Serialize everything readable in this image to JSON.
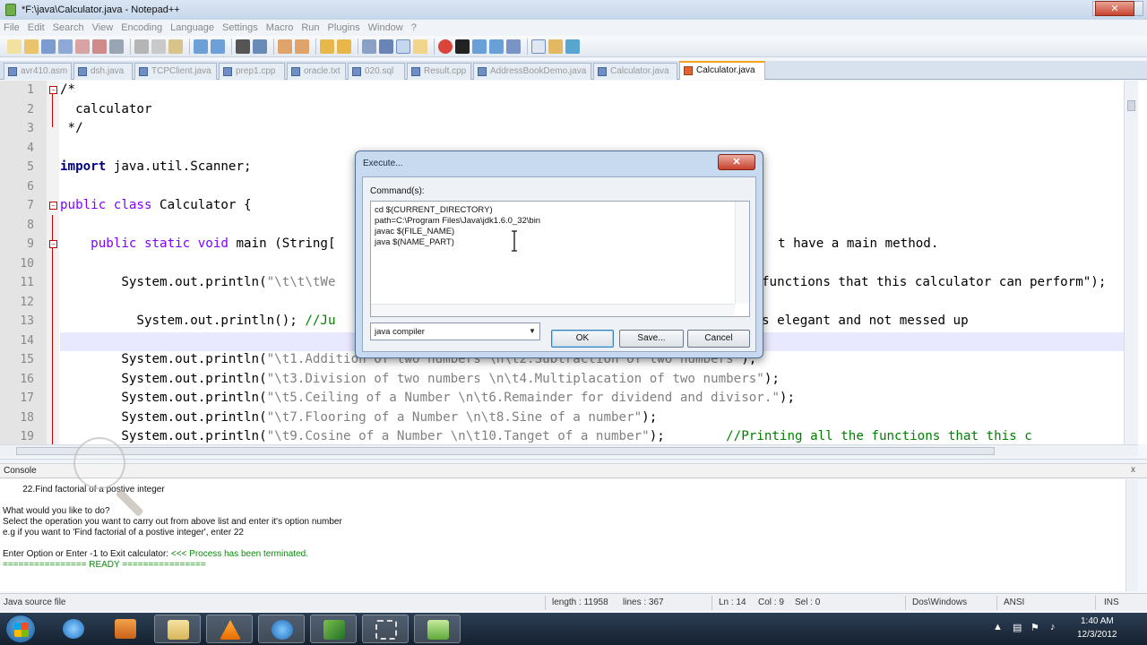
{
  "window": {
    "title": "*F:\\java\\Calculator.java - Notepad++"
  },
  "menu": [
    "File",
    "Edit",
    "Search",
    "View",
    "Encoding",
    "Language",
    "Settings",
    "Macro",
    "Run",
    "Plugins",
    "Window",
    "?"
  ],
  "tabs": [
    {
      "label": "avr410.asm",
      "active": false
    },
    {
      "label": "dsh.java",
      "active": false
    },
    {
      "label": "TCPClient.java",
      "active": false
    },
    {
      "label": "prep1.cpp",
      "active": false
    },
    {
      "label": "oracle.txt",
      "active": false
    },
    {
      "label": "020.sql",
      "active": false
    },
    {
      "label": "Result.cpp",
      "active": false
    },
    {
      "label": "AddressBookDemo.java",
      "active": false
    },
    {
      "label": "Calculator.java",
      "active": false
    },
    {
      "label": "Calculator.java",
      "active": true
    }
  ],
  "editor": {
    "line_numbers": [
      "1",
      "2",
      "3",
      "4",
      "5",
      "6",
      "7",
      "8",
      "9",
      "10",
      "11",
      "12",
      "13",
      "14",
      "15",
      "16",
      "17",
      "18",
      "19"
    ],
    "lines": {
      "l1": "/*",
      "l2": "  calculator",
      "l3": " */",
      "l5_kw": "import",
      "l5_rest": " java.util.Scanner;",
      "l7_kw": "public class",
      "l7_rest": " Calculator {",
      "l9_kw": "    public static void",
      "l9_rest": " main (String[",
      "l9_comment": "t have a main method.",
      "l11_a": "        System.out.println(",
      "l11_str": "\"\\t\\t\\tWe",
      "l11_right": "functions that this calculator can perform\");",
      "l13_a": "          System.out.println(); ",
      "l13_cm": "//Ju",
      "l13_right": "s elegant and not messed up",
      "l15_a": "        System.out.println(",
      "l15_str": "\"\\t1.Addition of two numbers \\n\\t2.Subtraction of two numbers\"",
      "l15_b": ");",
      "l16_a": "        System.out.println(",
      "l16_str": "\"\\t3.Division of two numbers \\n\\t4.Multiplacation of two numbers\"",
      "l16_b": ");",
      "l17_a": "        System.out.println(",
      "l17_str": "\"\\t5.Ceiling of a Number \\n\\t6.Remainder for dividend and divisor.\"",
      "l17_b": ");",
      "l18_a": "        System.out.println(",
      "l18_str": "\"\\t7.Flooring of a Number \\n\\t8.Sine of a number\"",
      "l18_b": ");",
      "l19_a": "        System.out.println(",
      "l19_str": "\"\\t9.Cosine of a Number \\n\\t10.Tanget of a number\"",
      "l19_b": ");        ",
      "l19_cm": "//Printing all the functions that this c"
    }
  },
  "console": {
    "header": "Console",
    "close": "x",
    "lines": [
      "        22.Find factorial of a postive integer",
      "What would you like to do?",
      "Select the operation you want to carry out from above list and enter it's option number",
      "e.g if you want to 'Find factorial of a postive integer', enter 22"
    ],
    "exit_prompt": "Enter Option or Enter -1 to Exit calculator: ",
    "terminated": "<<< Process has been terminated.",
    "ready": "================ READY ================"
  },
  "status": {
    "file_type": "Java source file",
    "length": "length : 11958",
    "lines": "lines : 367",
    "ln": "Ln : 14",
    "col": "Col : 9",
    "sel": "Sel : 0",
    "eol": "Dos\\Windows",
    "encoding": "ANSI",
    "mode": "INS"
  },
  "dialog": {
    "title": "Execute...",
    "close": "x",
    "commands_label": "Command(s):",
    "commands": [
      "cd $(CURRENT_DIRECTORY)",
      "path=C:\\Program Files\\Java\\jdk1.6.0_32\\bin",
      "javac $(FILE_NAME)",
      "java $(NAME_PART)"
    ],
    "selected_profile": "java compiler",
    "ok": "OK",
    "save": "Save...",
    "cancel": "Cancel"
  },
  "taskbar": {
    "time": "1:40 AM",
    "date": "12/3/2012",
    "icons": [
      "start-icon",
      "ie-icon",
      "media-player-icon",
      "explorer-icon",
      "vlc-icon",
      "app-icon",
      "app2-icon",
      "screen-capture-icon",
      "notepadpp-icon"
    ]
  },
  "colors": {
    "keyword": "#000080",
    "type_keyword": "#8000ff",
    "comment": "#008000",
    "string": "#808080",
    "active_tab_accent": "#f7a21b"
  }
}
